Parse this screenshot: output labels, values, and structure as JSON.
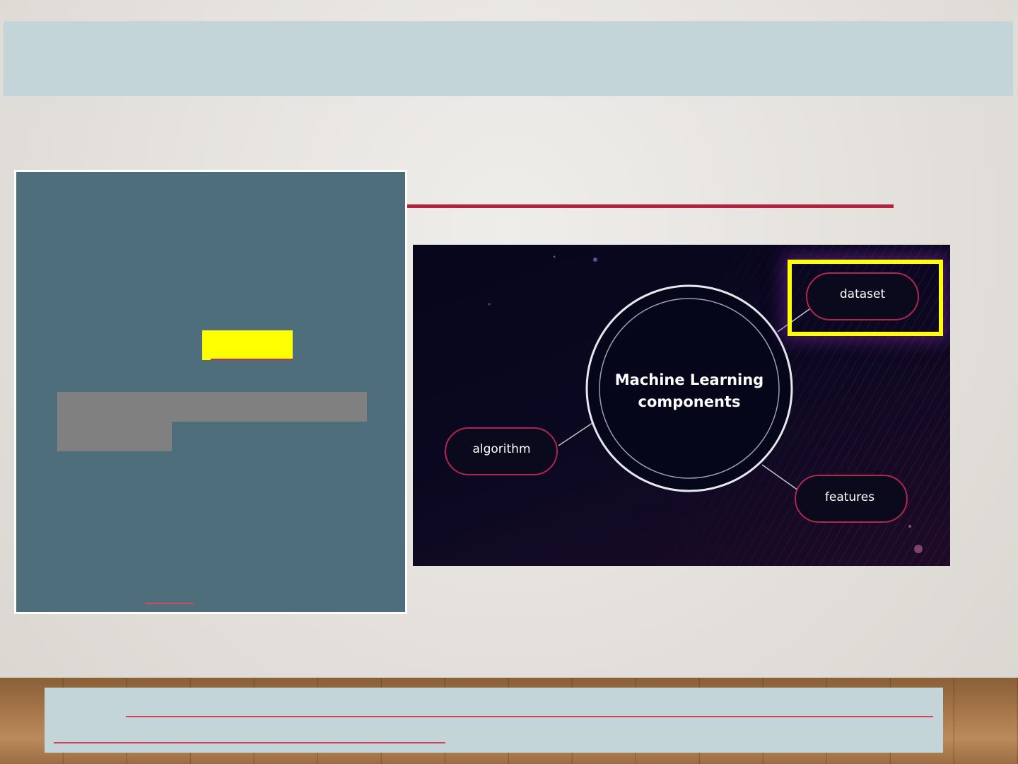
{
  "diagram": {
    "center_title_line1": "Machine Learning",
    "center_title_line2": "components",
    "nodes": {
      "dataset": "dataset",
      "algorithm": "algorithm",
      "features": "features"
    },
    "highlighted_node": "dataset"
  },
  "colors": {
    "header_bar": "#c4d5da",
    "left_panel": "#4f6e7b",
    "accent_rule": "#b5213d",
    "highlight": "#ffff00",
    "redaction_gray": "#808080"
  }
}
